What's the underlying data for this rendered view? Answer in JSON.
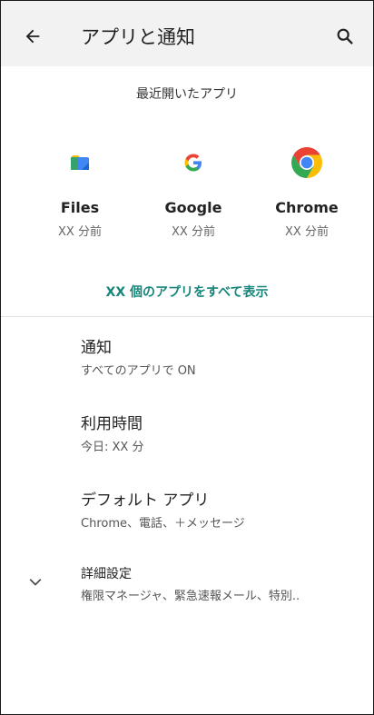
{
  "appbar": {
    "title": "アプリと通知",
    "back_icon": "arrow-back-icon",
    "search_icon": "search-icon"
  },
  "recent": {
    "header": "最近開いたアプリ",
    "apps": [
      {
        "name": "Files",
        "time": "XX 分前",
        "icon": "files-icon"
      },
      {
        "name": "Google",
        "time": "XX 分前",
        "icon": "google-icon"
      },
      {
        "name": "Chrome",
        "time": "XX 分前",
        "icon": "chrome-icon"
      }
    ],
    "show_all": "XX 個のアプリをすべて表示"
  },
  "settings": [
    {
      "title": "通知",
      "subtitle": "すべてのアプリで ON"
    },
    {
      "title": "利用時間",
      "subtitle": "今日: XX 分"
    },
    {
      "title": "デフォルト アプリ",
      "subtitle": "Chrome、電話、＋メッセージ"
    },
    {
      "title": "詳細設定",
      "subtitle": "権限マネージャ、緊急速報メール、特別.."
    }
  ],
  "colors": {
    "accent": "#16857a",
    "appbar_bg": "#f2f2f2"
  }
}
